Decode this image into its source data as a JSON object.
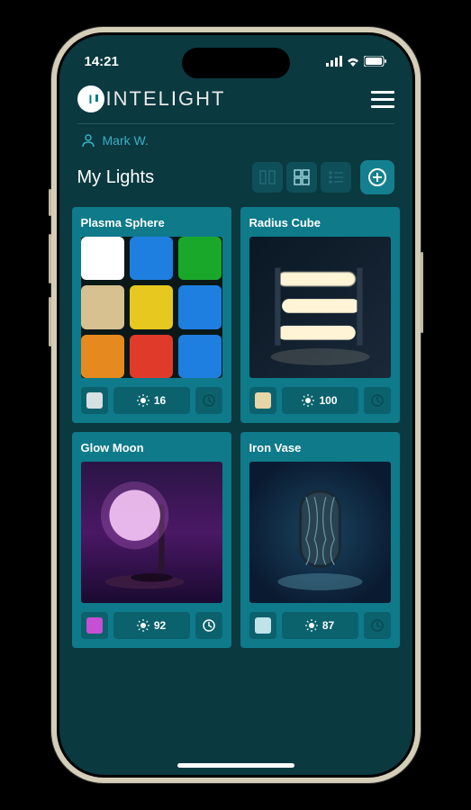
{
  "status": {
    "time": "14:21"
  },
  "brand": {
    "text": "INTELIGHT"
  },
  "user": {
    "name": "Mark W."
  },
  "section": {
    "title": "My Lights"
  },
  "lights": [
    {
      "name": "Plasma Sphere",
      "brightness": "16",
      "chip_color": "#d7e0e2",
      "timer_on": false,
      "palette": [
        "#ffffff",
        "#1f7fe0",
        "#1aa82b",
        "#d8c191",
        "#e6c81f",
        "#1f7fe0",
        "#e68a1f",
        "#e03a2b",
        "#1f7fe0"
      ]
    },
    {
      "name": "Radius Cube",
      "brightness": "100",
      "chip_color": "#e6d5a8",
      "timer_on": false
    },
    {
      "name": "Glow Moon",
      "brightness": "92",
      "chip_color": "#c74fd4",
      "timer_on": true
    },
    {
      "name": "Iron Vase",
      "brightness": "87",
      "chip_color": "#bfe3e8",
      "timer_on": false
    }
  ]
}
